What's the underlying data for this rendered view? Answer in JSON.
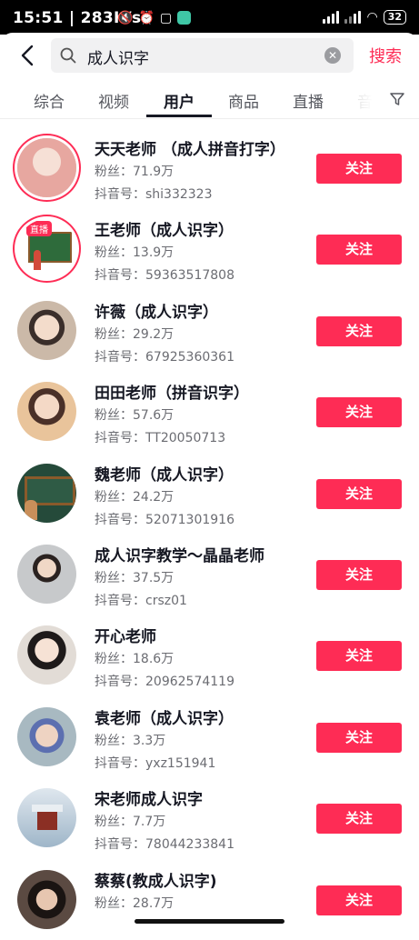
{
  "status": {
    "time": "15:51",
    "speed": "283K/s",
    "battery": "32"
  },
  "search": {
    "query": "成人识字",
    "button": "搜索"
  },
  "tabs": [
    "综合",
    "视频",
    "用户",
    "商品",
    "直播",
    "音"
  ],
  "users": [
    {
      "name": "天天老师 （成人拼音打字）",
      "fans": "粉丝：71.9万",
      "uid": "抖音号：shi332323",
      "follow": "关注",
      "avatar_color": "#e7a7a0"
    },
    {
      "name": "王老师（成人识字）",
      "fans": "粉丝：13.9万",
      "uid": "抖音号：59363517808",
      "follow": "关注",
      "avatar_color": "#2e6b3b",
      "live": "直播"
    },
    {
      "name": "许薇（成人识字）",
      "fans": "粉丝：29.2万",
      "uid": "抖音号：67925360361",
      "follow": "关注",
      "avatar_color": "#cbb9a8"
    },
    {
      "name": "田田老师（拼音识字）",
      "fans": "粉丝：57.6万",
      "uid": "抖音号：TT20050713",
      "follow": "关注",
      "avatar_color": "#d9b58e"
    },
    {
      "name": "魏老师（成人识字）",
      "fans": "粉丝：24.2万",
      "uid": "抖音号：52071301916",
      "follow": "关注",
      "avatar_color": "#254a3a"
    },
    {
      "name": "成人识字教学～晶晶老师",
      "fans": "粉丝：37.5万",
      "uid": "抖音号：crsz01",
      "follow": "关注",
      "avatar_color": "#bfc3c6"
    },
    {
      "name": "开心老师",
      "fans": "粉丝：18.6万",
      "uid": "抖音号：20962574119",
      "follow": "关注",
      "avatar_color": "#d6d0cb"
    },
    {
      "name": "袁老师（成人识字）",
      "fans": "粉丝：3.3万",
      "uid": "抖音号：yxz151941",
      "follow": "关注",
      "avatar_color": "#8fa9b5"
    },
    {
      "name": "宋老师成人识字",
      "fans": "粉丝：7.7万",
      "uid": "抖音号：78044233841",
      "follow": "关注",
      "avatar_color": "#9fb6c9"
    },
    {
      "name": "蔡蔡(教成人识字)",
      "fans": "粉丝：28.7万",
      "uid": "",
      "follow": "关注",
      "avatar_color": "#5b4a42"
    }
  ]
}
